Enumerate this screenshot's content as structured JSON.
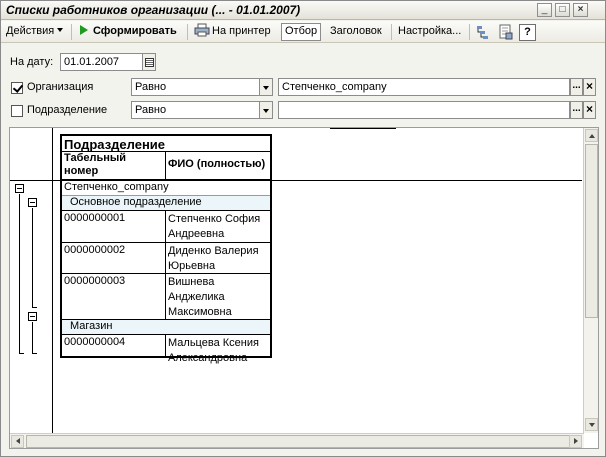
{
  "window": {
    "title": "Списки работников организации (... - 01.01.2007)",
    "min_glyph": "_",
    "max_glyph": "□",
    "close_glyph": "×"
  },
  "toolbar": {
    "actions_label": "Действия",
    "generate_label": "Сформировать",
    "print_label": "На принтер",
    "filter_label": "Отбор",
    "header_label": "Заголовок",
    "settings_label": "Настройка...",
    "help_glyph": "?"
  },
  "filters": {
    "date_label": "На дату:",
    "date_value": "01.01.2007",
    "org": {
      "label": "Организация",
      "checked": true,
      "condition": "Равно",
      "value": "Степченко_company"
    },
    "dept": {
      "label": "Подразделение",
      "checked": false,
      "condition": "Равно",
      "value": ""
    },
    "pick_glyph": "...",
    "clear_glyph": "×"
  },
  "report": {
    "group_header": "Подразделение",
    "col_tab": "Табельный номер",
    "col_tab_line1": "Табельный",
    "col_tab_line2": "номер",
    "col_fio": "ФИО (полностью)",
    "org_row": "Степченко_company",
    "groups": [
      {
        "name": "Основное подразделение",
        "rows": [
          {
            "tab": "0000000001",
            "fio_lines": [
              "Степченко София",
              "Андреевна"
            ]
          },
          {
            "tab": "0000000002",
            "fio_lines": [
              "Диденко Валерия",
              "Юрьевна"
            ]
          },
          {
            "tab": "0000000003",
            "fio_lines": [
              "Вишнева",
              "Анджелика",
              "Максимовна"
            ]
          }
        ]
      },
      {
        "name": "Магазин",
        "rows": [
          {
            "tab": "0000000004",
            "fio_lines": [
              "Мальцева Ксения",
              "Александровна"
            ]
          }
        ]
      }
    ]
  },
  "colors": {
    "group_row_bg": "#ecf6fa",
    "org_row_bg": "#ffffff",
    "generate_icon": "#1e9a1e"
  }
}
